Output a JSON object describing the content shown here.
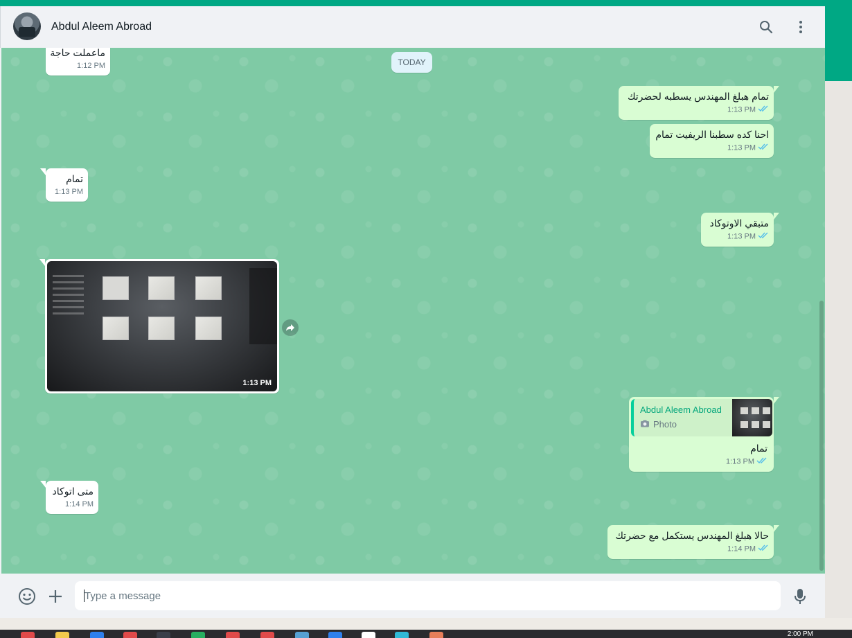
{
  "header": {
    "contact_name": "Abdul Aleem Abroad",
    "icons": [
      "search-icon",
      "menu-dots-icon"
    ]
  },
  "chat": {
    "date_chip": "TODAY",
    "messages": [
      {
        "direction": "in",
        "text": "ماعملت حاجة",
        "time": "1:12 PM"
      },
      {
        "direction": "out",
        "text": "تمام هبلغ المهندس يسطبه لحضرتك",
        "time": "1:13 PM",
        "status": "read"
      },
      {
        "direction": "out",
        "text": "احنا كده سطبنا الريفيت تمام",
        "time": "1:13 PM",
        "status": "read"
      },
      {
        "direction": "in",
        "text": "تمام",
        "time": "1:13 PM"
      },
      {
        "direction": "out",
        "text": "متبقي الاوتوكاد",
        "time": "1:13 PM",
        "status": "read"
      },
      {
        "direction": "in",
        "type": "photo",
        "time": "1:13 PM"
      },
      {
        "direction": "out",
        "quote": {
          "author": "Abdul Aleem Abroad",
          "label": "Photo"
        },
        "text": "تمام",
        "time": "1:13 PM",
        "status": "read"
      },
      {
        "direction": "in",
        "text": "متى اتوكاد",
        "time": "1:14 PM"
      },
      {
        "direction": "out",
        "text": "حالا هبلغ المهندس يستكمل مع حضرتك",
        "time": "1:14 PM",
        "status": "read"
      }
    ]
  },
  "composer": {
    "placeholder": "Type a message",
    "icons": [
      "emoji-icon",
      "plus-icon",
      "microphone-icon"
    ]
  },
  "taskbar": {
    "clock": "2:00 PM"
  },
  "colors": {
    "accent": "#00a884",
    "chat_bg": "#7fcaa5",
    "bubble_out": "#d9fdd3",
    "bubble_in": "#ffffff",
    "read_tick": "#53bdeb"
  }
}
